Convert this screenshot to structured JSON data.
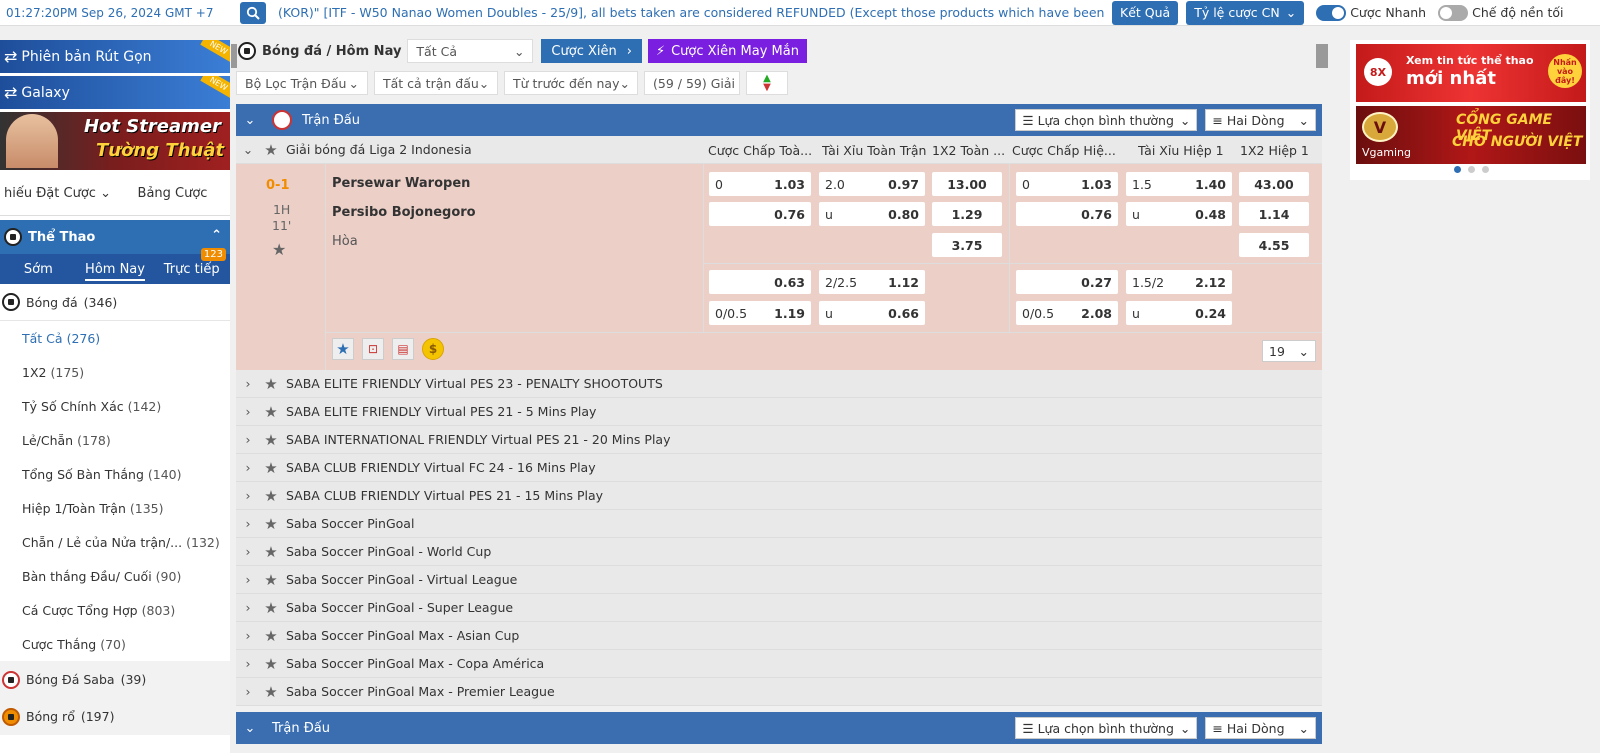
{
  "topbar": {
    "datetime": "01:27:20PM Sep 26, 2024 GMT +7",
    "marquee": "(KOR)\" [ITF - W50 Nanao Women Doubles - 25/9], all bets taken are considered REFUNDED (Except those products which have been",
    "results_btn": "Kết Quả",
    "odds_type": "Tỷ lệ cược CN",
    "quick_bet": "Cược Nhanh",
    "bg_mode": "Chế độ nền tối"
  },
  "sidebar": {
    "banner1": "Phiên bản Rút Gọn",
    "banner2": "Galaxy",
    "new_tag": "NEW",
    "hot1": "Hot Streamer",
    "hot2": "Tường Thuật",
    "bet_tabs": [
      "hiếu Đặt Cược",
      "Bảng Cược"
    ],
    "sport_head": "Thể Thao",
    "time_tabs": [
      "Sớm",
      "Hôm Nay",
      "Trực tiếp"
    ],
    "live_badge": "123",
    "football": {
      "name": "Bóng đá",
      "count": "(346)"
    },
    "items": [
      {
        "name": "Tất Cả",
        "count": "(276)"
      },
      {
        "name": "1X2",
        "count": "(175)"
      },
      {
        "name": "Tỷ Số Chính Xác",
        "count": "(142)"
      },
      {
        "name": "Lẻ/Chẵn",
        "count": "(178)"
      },
      {
        "name": "Tổng Số Bàn Thắng",
        "count": "(140)"
      },
      {
        "name": "Hiệp 1/Toàn Trận",
        "count": "(135)"
      },
      {
        "name": "Chẵn / Lẻ của Nửa trận/...",
        "count": "(132)"
      },
      {
        "name": "Bàn thắng Đầu/ Cuối",
        "count": "(90)"
      },
      {
        "name": "Cá Cược Tổng Hợp",
        "count": "(803)"
      },
      {
        "name": "Cược Thắng",
        "count": "(70)"
      }
    ],
    "saba": {
      "name": "Bóng Đá Saba",
      "count": "(39)"
    },
    "basketball": {
      "name": "Bóng rổ",
      "count": "(197)"
    }
  },
  "main": {
    "title": "Bóng đá / Hôm Nay",
    "filter_all": "Tất Cả",
    "parlay": "Cược Xiên",
    "lucky_parlay": "Cược Xiên May Mắn",
    "match_filter": "Bộ Lọc Trận Đấu",
    "all_matches": "Tất cả trận đấu",
    "from_before": "Từ trước đến nay",
    "leagues_count": "(59 / 59) Giải",
    "section_title": "Trận Đấu",
    "normal_select": "Lựa chọn bình thường",
    "two_lines": "Hai Dòng",
    "league": "Giải bóng đá Liga 2 Indonesia",
    "columns": [
      "Cược Chấp Toà...",
      "Tài Xỉu Toàn Trận",
      "1X2 Toàn ...",
      "Cược Chấp Hiệ...",
      "Tài Xỉu Hiệp 1",
      "1X2 Hiệp 1"
    ],
    "match": {
      "score": "0-1",
      "period": "1H",
      "minute": "11'",
      "home": "Persewar Waropen",
      "away": "Persibo Bojonegoro",
      "draw": "Hòa",
      "more": "19"
    },
    "odds": {
      "r1": {
        "hc_h": "0",
        "hc_v": "1.03",
        "ou_h": "2.0",
        "ou_v": "0.97",
        "x": "13.00",
        "hc1_h": "0",
        "hc1_v": "1.03",
        "ou1_h": "1.5",
        "ou1_v": "1.40",
        "x1": "43.00"
      },
      "r2": {
        "hc_v": "0.76",
        "ou_h": "u",
        "ou_v": "0.80",
        "x": "1.29",
        "hc1_v": "0.76",
        "ou1_h": "u",
        "ou1_v": "0.48",
        "x1": "1.14"
      },
      "r3": {
        "x": "3.75",
        "x1": "4.55"
      },
      "r4": {
        "hc_v": "0.63",
        "ou_h": "2/2.5",
        "ou_v": "1.12",
        "hc1_v": "0.27",
        "ou1_h": "1.5/2",
        "ou1_v": "2.12"
      },
      "r5": {
        "hc_h": "0/0.5",
        "hc_v": "1.19",
        "ou_h": "u",
        "ou_v": "0.66",
        "hc1_h": "0/0.5",
        "hc1_v": "2.08",
        "ou1_h": "u",
        "ou1_v": "0.24"
      }
    },
    "leagues": [
      "SABA ELITE FRIENDLY Virtual PES 23 - PENALTY SHOOTOUTS",
      "SABA ELITE FRIENDLY Virtual PES 21 - 5 Mins Play",
      "SABA INTERNATIONAL FRIENDLY Virtual PES 21 - 20 Mins Play",
      "SABA CLUB FRIENDLY Virtual FC 24 - 16 Mins Play",
      "SABA CLUB FRIENDLY Virtual PES 21 - 15 Mins Play",
      "Saba Soccer PinGoal",
      "Saba Soccer PinGoal - World Cup",
      "Saba Soccer PinGoal - Virtual League",
      "Saba Soccer PinGoal - Super League",
      "Saba Soccer PinGoal Max - Asian Cup",
      "Saba Soccer PinGoal Max - Copa América",
      "Saba Soccer PinGoal Max - Premier League"
    ]
  },
  "ads": {
    "ad1_line1": "Xem tin tức thể thao",
    "ad1_line2": "mới nhất",
    "ad1_logo": "8X",
    "ad1_badge": "Nhấn vào đây!",
    "ad2_logo": "V",
    "ad2_name": "Vgaming",
    "ad2_line1": "CỔNG GAME VIỆT",
    "ad2_line2": "CHO NGƯỜI VIỆT"
  }
}
